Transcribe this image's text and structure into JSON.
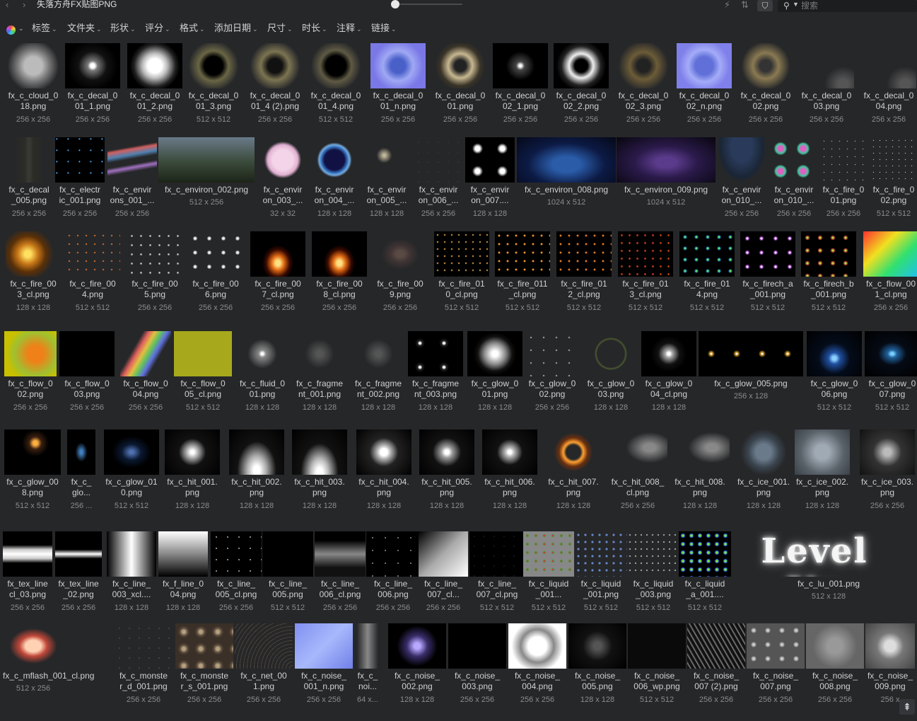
{
  "window": {
    "title": "失落方舟FX贴图PNG"
  },
  "nav": {
    "back": "‹",
    "forward": "›"
  },
  "toolbar": {
    "bolt_icon": "⚡",
    "sort_icon": "⇅",
    "filter_icon": "⛉"
  },
  "search": {
    "placeholder": "搜索",
    "icon": "search-icon"
  },
  "filters": [
    {
      "label": "标签"
    },
    {
      "label": "文件夹"
    },
    {
      "label": "形状"
    },
    {
      "label": "评分"
    },
    {
      "label": "格式"
    },
    {
      "label": "添加日期"
    },
    {
      "label": "尺寸"
    },
    {
      "label": "时长"
    },
    {
      "label": "注释"
    },
    {
      "label": "链接"
    }
  ],
  "items": [
    {
      "name": "fx_c_cloud_0\n18.png",
      "size": "256 x 256"
    },
    {
      "name": "fx_c_decal_0\n01_1.png",
      "size": "256 x 256"
    },
    {
      "name": "fx_c_decal_0\n01_2.png",
      "size": "256 x 256"
    },
    {
      "name": "fx_c_decal_0\n01_3.png",
      "size": "512 x 512"
    },
    {
      "name": "fx_c_decal_0\n01_4 (2).png",
      "size": "256 x 256"
    },
    {
      "name": "fx_c_decal_0\n01_4.png",
      "size": "512 x 512"
    },
    {
      "name": "fx_c_decal_0\n01_n.png",
      "size": "256 x 256"
    },
    {
      "name": "fx_c_decal_0\n01.png",
      "size": "256 x 256"
    },
    {
      "name": "fx_c_decal_0\n02_1.png",
      "size": "256 x 256"
    },
    {
      "name": "fx_c_decal_0\n02_2.png",
      "size": "256 x 256"
    },
    {
      "name": "fx_c_decal_0\n02_3.png",
      "size": "256 x 256"
    },
    {
      "name": "fx_c_decal_0\n02_n.png",
      "size": "256 x 256"
    },
    {
      "name": "fx_c_decal_0\n02.png",
      "size": "256 x 256"
    },
    {
      "name": "fx_c_decal_0\n03.png",
      "size": "256 x 256"
    },
    {
      "name": "fx_c_decal_0\n04.png",
      "size": "256 x 256"
    },
    {
      "name": "fx_c_decal\n_005.png",
      "size": "256 x 256"
    },
    {
      "name": "fx_c_electr\nic_001.png",
      "size": "256 x 256"
    },
    {
      "name": "fx_c_envir\nons_001_...",
      "size": "256 x 256"
    },
    {
      "name": "fx_c_environ_002.png",
      "size": "512 x 256"
    },
    {
      "name": "fx_c_envir\non_003_...",
      "size": "32 x 32"
    },
    {
      "name": "fx_c_envir\non_004_...",
      "size": "128 x 128"
    },
    {
      "name": "fx_c_envir\non_005_...",
      "size": "128 x 128"
    },
    {
      "name": "fx_c_envir\non_006_...",
      "size": "256 x 256"
    },
    {
      "name": "fx_c_envir\non_007....",
      "size": "128 x 128"
    },
    {
      "name": "fx_c_environ_008.png",
      "size": "1024 x 512"
    },
    {
      "name": "fx_c_environ_009.png",
      "size": "1024 x 512"
    },
    {
      "name": "fx_c_envir\non_010_...",
      "size": "256 x 256"
    },
    {
      "name": "fx_c_envir\non_010_...",
      "size": "256 x 256"
    },
    {
      "name": "fx_c_fire_0\n01.png",
      "size": "256 x 256"
    },
    {
      "name": "fx_c_fire_0\n02.png",
      "size": "512 x 512"
    },
    {
      "name": "fx_c_fire_00\n3_cl.png",
      "size": "128 x 128"
    },
    {
      "name": "fx_c_fire_00\n4.png",
      "size": "512 x 512"
    },
    {
      "name": "fx_c_fire_00\n5.png",
      "size": "256 x 256"
    },
    {
      "name": "fx_c_fire_00\n6.png",
      "size": "256 x 256"
    },
    {
      "name": "fx_c_fire_00\n7_cl.png",
      "size": "256 x 256"
    },
    {
      "name": "fx_c_fire_00\n8_cl.png",
      "size": "256 x 256"
    },
    {
      "name": "fx_c_fire_00\n9.png",
      "size": "256 x 256"
    },
    {
      "name": "fx_c_fire_01\n0_cl.png",
      "size": "512 x 512"
    },
    {
      "name": "fx_c_fire_011\n_cl.png",
      "size": "512 x 512"
    },
    {
      "name": "fx_c_fire_01\n2_cl.png",
      "size": "512 x 512"
    },
    {
      "name": "fx_c_fire_01\n3_cl.png",
      "size": "512 x 512"
    },
    {
      "name": "fx_c_fire_01\n4.png",
      "size": "512 x 512"
    },
    {
      "name": "fx_c_firech_a\n_001.png",
      "size": "512 x 512"
    },
    {
      "name": "fx_c_firech_b\n_001.png",
      "size": "512 x 512"
    },
    {
      "name": "fx_c_flow_00\n1_cl.png",
      "size": "256 x 256"
    },
    {
      "name": "fx_c_flow_0\n02.png",
      "size": "256 x 256"
    },
    {
      "name": "fx_c_flow_0\n03.png",
      "size": "256 x 256"
    },
    {
      "name": "fx_c_flow_0\n04.png",
      "size": "256 x 256"
    },
    {
      "name": "fx_c_flow_0\n05_cl.png",
      "size": "512 x 512"
    },
    {
      "name": "fx_c_fluid_0\n01.png",
      "size": "128 x 128"
    },
    {
      "name": "fx_c_fragme\nnt_001.png",
      "size": "128 x 128"
    },
    {
      "name": "fx_c_fragme\nnt_002.png",
      "size": "128 x 128"
    },
    {
      "name": "fx_c_fragme\nnt_003.png",
      "size": "128 x 128"
    },
    {
      "name": "fx_c_glow_0\n01.png",
      "size": "128 x 128"
    },
    {
      "name": "fx_c_glow_0\n02.png",
      "size": "256 x 256"
    },
    {
      "name": "fx_c_glow_0\n03.png",
      "size": "128 x 128"
    },
    {
      "name": "fx_c_glow_0\n04_cl.png",
      "size": "128 x 128"
    },
    {
      "name": "fx_c_glow_005.png",
      "size": "256 x 128"
    },
    {
      "name": "fx_c_glow_0\n06.png",
      "size": "512 x 512"
    },
    {
      "name": "fx_c_glow_0\n07.png",
      "size": "512 x 512"
    },
    {
      "name": "fx_c_glow_00\n8.png",
      "size": "512 x 512"
    },
    {
      "name": "fx_c_\nglo...",
      "size": "256 ..."
    },
    {
      "name": "fx_c_glow_01\n0.png",
      "size": "512 x 512"
    },
    {
      "name": "fx_c_hit_001.\npng",
      "size": "128 x 128"
    },
    {
      "name": "fx_c_hit_002.\npng",
      "size": "128 x 128"
    },
    {
      "name": "fx_c_hit_003.\npng",
      "size": "128 x 128"
    },
    {
      "name": "fx_c_hit_004.\npng",
      "size": "128 x 128"
    },
    {
      "name": "fx_c_hit_005.\npng",
      "size": "128 x 128"
    },
    {
      "name": "fx_c_hit_006.\npng",
      "size": "128 x 128"
    },
    {
      "name": "fx_c_hit_007.\npng",
      "size": "128 x 128"
    },
    {
      "name": "fx_c_hit_008_\ncl.png",
      "size": "256 x 256"
    },
    {
      "name": "fx_c_hit_008.\npng",
      "size": "128 x 128"
    },
    {
      "name": "fx_c_ice_001.\npng",
      "size": "128 x 128"
    },
    {
      "name": "fx_c_ice_002.\npng",
      "size": "128 x 128"
    },
    {
      "name": "fx_c_ice_003.\npng",
      "size": "256 x 256"
    },
    {
      "name": "fx_tex_line\ncl_03.png",
      "size": "256 x 256"
    },
    {
      "name": "fx_tex_line\n_02.png",
      "size": "256 x 256"
    },
    {
      "name": "fx_c_line_\n003_xcl....",
      "size": "128 x 128"
    },
    {
      "name": "fx_f_line_0\n04.png",
      "size": "128 x 128"
    },
    {
      "name": "fx_c_line_\n005_cl.png",
      "size": "256 x 256"
    },
    {
      "name": "fx_c_line_\n005.png",
      "size": "512 x 512"
    },
    {
      "name": "fx_c_line_\n006_cl.png",
      "size": "256 x 256"
    },
    {
      "name": "fx_c_line_\n006.png",
      "size": "256 x 256"
    },
    {
      "name": "fx_c_line_\n007_cl...",
      "size": "256 x 256"
    },
    {
      "name": "fx_c_line_\n007_cl.png",
      "size": "512 x 512"
    },
    {
      "name": "fx_c_liquid\n_001...",
      "size": "512 x 512"
    },
    {
      "name": "fx_c_liquid\n_001.png",
      "size": "512 x 512"
    },
    {
      "name": "fx_c_liquid\n_003.png",
      "size": "512 x 512"
    },
    {
      "name": "fx_c_liquid\n_a_001....",
      "size": "512 x 512"
    },
    {
      "name": "fx_c_lu_001.png",
      "size": "512 x 128",
      "overlay": "Level Up"
    },
    {
      "name": "fx_c_mflash_001_cl.png",
      "size": "512 x 256"
    },
    {
      "name": "fx_c_monste\nr_d_001.png",
      "size": "256 x 256"
    },
    {
      "name": "fx_c_monste\nr_s_001.png",
      "size": "256 x 256"
    },
    {
      "name": "fx_c_net_00\n1.png",
      "size": "256 x 256"
    },
    {
      "name": "fx_c_noise_\n001_n.png",
      "size": "256 x 256"
    },
    {
      "name": "fx_c_\nnoi...",
      "size": "64 x..."
    },
    {
      "name": "fx_c_noise_\n002.png",
      "size": "128 x 128"
    },
    {
      "name": "fx_c_noise_\n003.png",
      "size": "256 x 256"
    },
    {
      "name": "fx_c_noise_\n004.png",
      "size": "256 x 256"
    },
    {
      "name": "fx_c_noise_\n005.png",
      "size": "128 x 128"
    },
    {
      "name": "fx_c_noise_\n006_wp.png",
      "size": "512 x 512"
    },
    {
      "name": "fx_c_noise_\n007 (2).png",
      "size": "256 x 256"
    },
    {
      "name": "fx_c_noise_\n007.png",
      "size": "256 x 256"
    },
    {
      "name": "fx_c_noise_\n008.png",
      "size": "256 x 256"
    },
    {
      "name": "fx_c_noise_\n009.png",
      "size": "256 x"
    }
  ],
  "scroll_top": "⇞"
}
